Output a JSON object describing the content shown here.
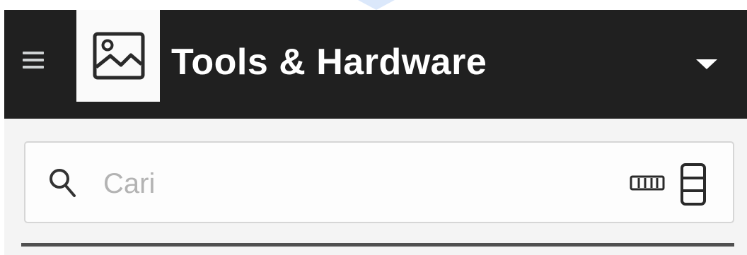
{
  "header": {
    "title": "Tools & Hardware",
    "background": "#202020",
    "title_color": "#ffffff",
    "menu_icon": "hamburger-menu-icon",
    "logo_icon": "image-placeholder-icon",
    "dropdown_icon": "caret-down-icon"
  },
  "search": {
    "placeholder": "Cari",
    "value": "",
    "icon": "search-icon",
    "barcode_icon": "barcode-icon",
    "scanner_icon": "scanner-icon"
  }
}
